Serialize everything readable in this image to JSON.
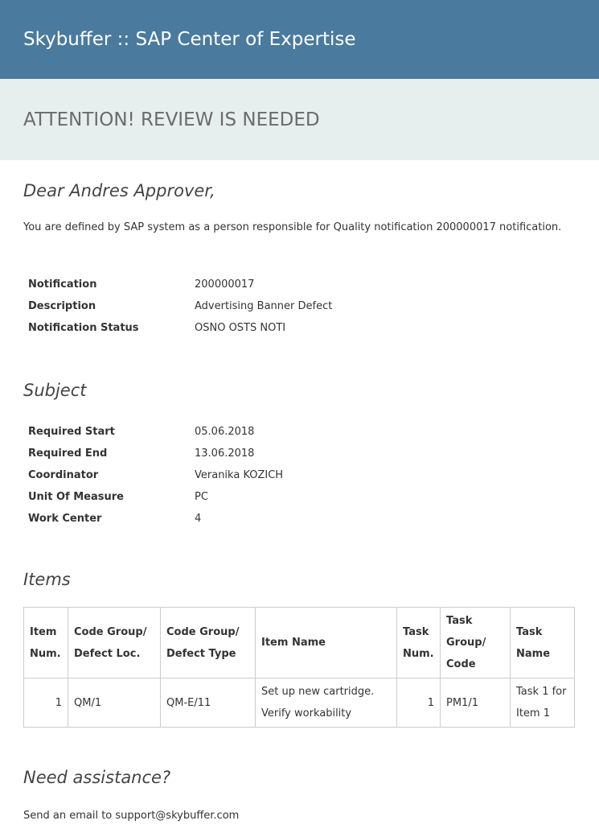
{
  "header": {
    "title": "Skybuffer :: SAP Center of Expertise"
  },
  "banner": {
    "title": "ATTENTION! REVIEW IS NEEDED"
  },
  "greeting": "Dear Andres Approver,",
  "intro": "You are defined by SAP system as a person responsible for Quality notification 200000017 notification.",
  "notification": [
    {
      "label": "Notification",
      "value": "200000017"
    },
    {
      "label": "Description",
      "value": "Advertising Banner Defect"
    },
    {
      "label": "Notification Status",
      "value": "OSNO OSTS NOTI"
    }
  ],
  "subject": {
    "heading": "Subject",
    "rows": [
      {
        "label": "Required Start",
        "value": "05.06.2018"
      },
      {
        "label": "Required End",
        "value": "13.06.2018"
      },
      {
        "label": "Coordinator",
        "value": "Veranika KOZICH"
      },
      {
        "label": "Unit Of Measure",
        "value": "PC"
      },
      {
        "label": "Work Center",
        "value": "4"
      }
    ]
  },
  "items": {
    "heading": "Items",
    "headers": [
      {
        "l1": "Item",
        "l2": "Num."
      },
      {
        "l1": "Code Group/",
        "l2": "Defect Loc."
      },
      {
        "l1": "Code Group/",
        "l2": "Defect Type"
      },
      {
        "l1": "Item Name"
      },
      {
        "l1": "Task",
        "l2": "Num."
      },
      {
        "l1": "Task",
        "l2": "Group/",
        "l3": "Code"
      },
      {
        "l1": "Task",
        "l2": "Name"
      }
    ],
    "rows": [
      {
        "item_num": "1",
        "defect_loc": "QM/1",
        "defect_type": "QM-E/11",
        "item_name_1": "Set up new cartridge.",
        "item_name_2": "Verify workability",
        "task_num": "1",
        "task_code": "PM1/1",
        "task_name_1": "Task 1 for",
        "task_name_2": "Item 1"
      }
    ]
  },
  "assistance": {
    "heading": "Need assistance?",
    "text": "Send an email to support@skybuffer.com"
  }
}
